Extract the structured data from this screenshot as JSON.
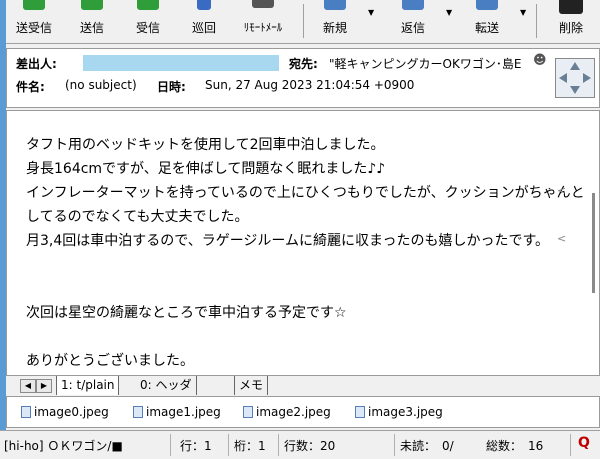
{
  "toolbar": {
    "buttons": [
      {
        "label": "送受信",
        "color": "#2e9d3a"
      },
      {
        "label": "送信",
        "color": "#2e9d3a"
      },
      {
        "label": "受信",
        "color": "#2e9d3a"
      },
      {
        "label": "巡回",
        "color": "#3a6bc4"
      },
      {
        "label": "ﾘﾓｰﾄﾒｰﾙ",
        "color": "#555555"
      },
      {
        "label": "新規",
        "color": "#4a7ec2"
      },
      {
        "label": "返信",
        "color": "#4a7ec2"
      },
      {
        "label": "転送",
        "color": "#4a7ec2"
      },
      {
        "label": "削除",
        "color": "#222222"
      }
    ]
  },
  "header": {
    "from_label": "差出人:",
    "to_label": "宛先:",
    "to_value": "\"軽キャンピングカーOKワゴン･島E",
    "subject_label": "件名:",
    "subject_value": "(no subject)",
    "date_label": "日時:",
    "date_value": "Sun, 27 Aug 2023 21:04:54 +0900"
  },
  "body": {
    "lines": [
      "タフト用のベッドキットを使用して2回車中泊しました。",
      "身長164cmですが、足を伸ばして問題なく眠れました♪♪",
      "インフレーターマットを持っているので上にひくつもりでしたが、クッションがちゃんと",
      "してるのでなくても大丈夫でした。",
      "月3,4回は車中泊するので、ラゲージルームに綺麗に収まったのも嬉しかったです。",
      "",
      "",
      "次回は星空の綺麗なところで車中泊する予定です☆",
      "",
      "ありがとうございました。"
    ],
    "wrap_mark": "<"
  },
  "tabs": [
    {
      "label": "1: t/plain"
    },
    {
      "label": "0: ヘッダ"
    },
    {
      "label": "メモ"
    }
  ],
  "attachments": [
    {
      "name": "image0.jpeg"
    },
    {
      "name": "image1.jpeg"
    },
    {
      "name": "image2.jpeg"
    },
    {
      "name": "image3.jpeg"
    }
  ],
  "status": {
    "folder": "[hi-ho] ＯＫワゴン/■",
    "line": "行：1",
    "col": "桁：1",
    "lines": "行数：20",
    "unread": "未読：　0/",
    "total": "総数：　16",
    "q": "Q"
  }
}
